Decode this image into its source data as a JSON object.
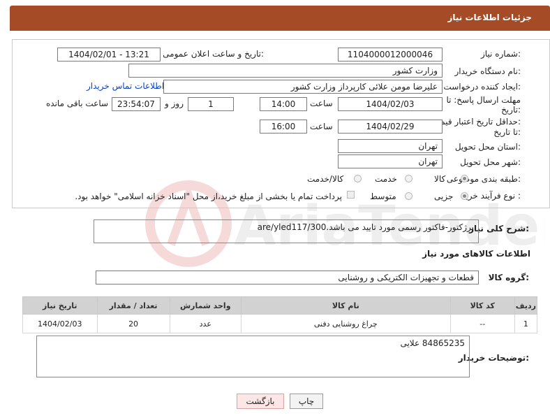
{
  "header": {
    "title": "جزئیات اطلاعات نیاز"
  },
  "form": {
    "need_number_label": "شماره نیاز:",
    "need_number": "1104000012000046",
    "announce_label": "تاریخ و ساعت اعلان عمومی:",
    "announce_value": "1404/02/01 - 13:21",
    "buyer_org_label": "نام دستگاه خریدار:",
    "buyer_org": "وزارت کشور",
    "requester_label": "ایجاد کننده درخواست:",
    "requester": "علیرضا مومن علائی کارپرداز وزارت کشور",
    "contact_link": "اطلاعات تماس خریدار",
    "deadline_label_1": "مهلت ارسال پاسخ: تا",
    "deadline_label_2": "تاریخ:",
    "deadline_date": "1404/02/03",
    "time_label": "ساعت",
    "deadline_time": "14:00",
    "days_value": "1",
    "days_label": "روز و",
    "remaining_time": "23:54:07",
    "remaining_label": "ساعت باقی مانده",
    "price_label_1": "حداقل تاریخ اعتبار قیمت:",
    "price_label_2": "تا تاریخ:",
    "price_date": "1404/02/29",
    "price_time": "16:00",
    "province_label": "استان محل تحویل:",
    "province": "تهران",
    "city_label": "شهر محل تحویل:",
    "city": "تهران",
    "category_label": "طبقه بندی موضوعی:",
    "category_options": [
      "کالا",
      "خدمت",
      "کالا/خدمت"
    ],
    "category_selected": "کالا",
    "purchase_type_label": "نوع فرآیند خرید :",
    "purchase_options": [
      "جزیی",
      "متوسط"
    ],
    "purchase_selected": "جزیی",
    "payment_note": "پرداخت تمام یا بخشی از مبلغ خرید،از محل \"اسناد خزانه اسلامی\" خواهد بود."
  },
  "description": {
    "label": "شرح کلی نیاز:",
    "value": "پرژکتور-فاکتور رسمی مورد تایید می باشد.are/yled117/300"
  },
  "goods": {
    "section_title": "اطلاعات کالاهای مورد نیاز",
    "group_label": "گروه کالا:",
    "group_value": "قطعات و تجهیزات الکتریکی و روشنایی",
    "columns": [
      "ردیف",
      "کد کالا",
      "نام کالا",
      "واحد شمارش",
      "تعداد / مقدار",
      "تاریخ نیاز"
    ],
    "rows": [
      {
        "row": "1",
        "code": "--",
        "name": "چراغ روشنایی دفنی",
        "unit": "عدد",
        "qty": "20",
        "date": "1404/02/03"
      }
    ]
  },
  "buyer_notes": {
    "label": "توضیحات خریدار:",
    "value": "84865235 علایی"
  },
  "buttons": {
    "print": "چاپ",
    "back": "بازگشت"
  },
  "watermark": "AriaTender.neT",
  "colors": {
    "header_bg": "#a54b26",
    "link": "#0a40c8"
  }
}
